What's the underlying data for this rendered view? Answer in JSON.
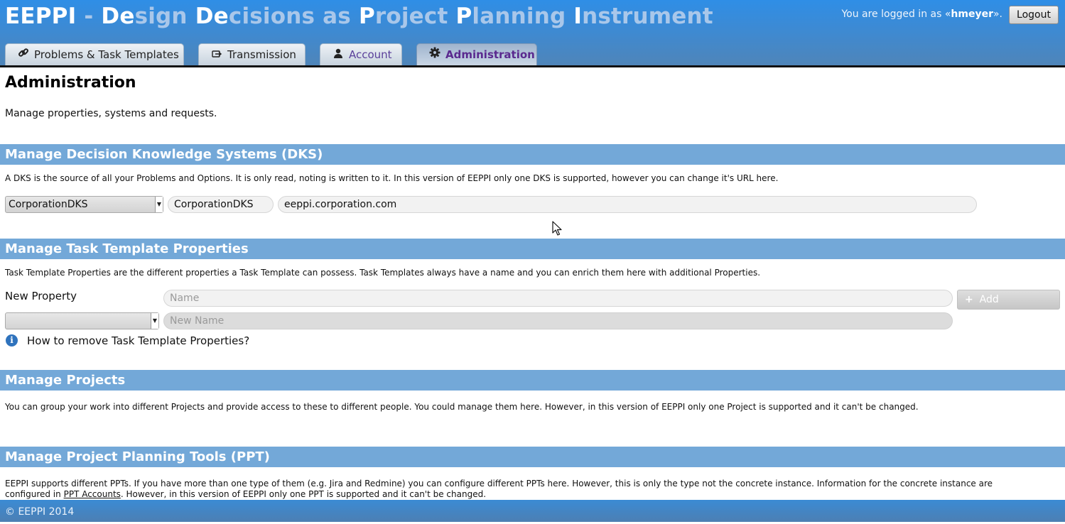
{
  "header": {
    "title_parts": [
      {
        "text": "EEPPI",
        "style": "w"
      },
      {
        "text": " - ",
        "style": "f"
      },
      {
        "text": "De",
        "style": "w"
      },
      {
        "text": "sign ",
        "style": "f"
      },
      {
        "text": "De",
        "style": "w"
      },
      {
        "text": "cisions as ",
        "style": "f"
      },
      {
        "text": "P",
        "style": "w"
      },
      {
        "text": "roject ",
        "style": "f"
      },
      {
        "text": "P",
        "style": "w"
      },
      {
        "text": "lanning ",
        "style": "f"
      },
      {
        "text": "I",
        "style": "w"
      },
      {
        "text": "nstrument",
        "style": "f"
      }
    ],
    "login_prefix": "You are logged in as «",
    "username": "hmeyer",
    "login_suffix": "».",
    "logout_label": "Logout"
  },
  "tabs": [
    {
      "label": "Problems & Task Templates",
      "icon": "link-icon"
    },
    {
      "label": "Transmission",
      "icon": "transmission-icon"
    },
    {
      "label": "Account",
      "icon": "user-icon"
    },
    {
      "label": "Administration",
      "icon": "gear-icon",
      "active": true
    }
  ],
  "page": {
    "title": "Administration",
    "intro": "Manage properties, systems and requests."
  },
  "dks": {
    "heading": "Manage Decision Knowledge Systems (DKS)",
    "description": "A DKS is the source of all your Problems and Options. It is only read, noting is written to it. In this version of EEPPI only one DKS is supported, however you can change it's URL here.",
    "selected": "CorporationDKS",
    "name_value": "CorporationDKS",
    "url_value": "eeppi.corporation.com"
  },
  "task_props": {
    "heading": "Manage Task Template Properties",
    "description": "Task Template Properties are the different properties a Task Template can possess. Task Templates always have a name and you can enrich them here with additional Properties.",
    "new_property_label": "New Property",
    "name_placeholder": "Name",
    "add_label": "Add",
    "new_name_placeholder": "New Name",
    "help_link": "How to remove Task Template Properties?"
  },
  "projects": {
    "heading": "Manage Projects",
    "description": "You can group your work into different Projects and provide access to these to different people. You could manage them here. However, in this version of EEPPI only one Project is supported and it can't be changed."
  },
  "ppt": {
    "heading": "Manage Project Planning Tools (PPT)",
    "description_before": "EEPPI supports different PPTs. If you have more than one type of them (e.g. Jira and Redmine) you can configure different PPTs here. However, this is only the type not the concrete instance. Information for the concrete instance are configured in ",
    "link": "PPT Accounts",
    "description_after": ". However, in this version of EEPPI only one PPT is supported and it can't be changed."
  },
  "footer": {
    "text": "© EEPPI 2014"
  },
  "colors": {
    "header_blue": "#2f8ee6",
    "section_blue": "#73a8d8",
    "active_tab_text": "#5a2a8f"
  }
}
